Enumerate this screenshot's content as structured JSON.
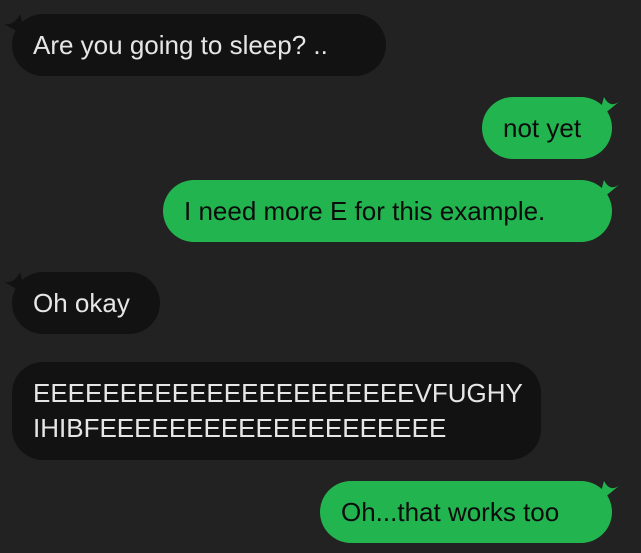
{
  "colors": {
    "background": "#222222",
    "incoming_bubble": "#121212",
    "outgoing_bubble": "#22b54f"
  },
  "messages": [
    {
      "direction": "incoming",
      "text": "Are you going to sleep? .."
    },
    {
      "direction": "outgoing",
      "text": "not yet"
    },
    {
      "direction": "outgoing",
      "text": "I need more E for this example."
    },
    {
      "direction": "incoming",
      "text": "Oh okay"
    },
    {
      "direction": "incoming",
      "lines": [
        "EEEEEEEEEEEEEEEEEEEEEEVFUGHY",
        "IHIBFEEEEEEEEEEEEEEEEEEEE"
      ]
    },
    {
      "direction": "outgoing",
      "text": "Oh...that works too"
    }
  ]
}
